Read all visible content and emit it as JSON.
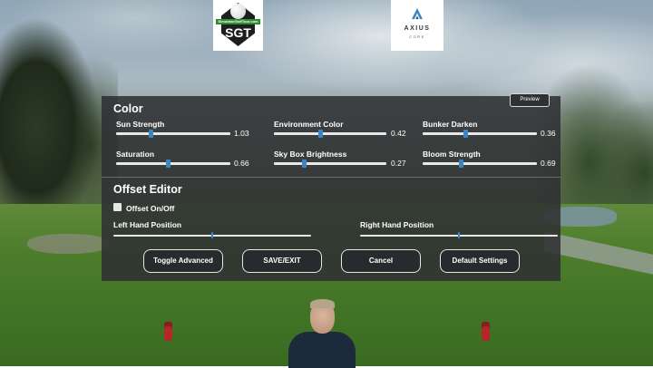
{
  "logos": {
    "sgt": {
      "band_text": "SimulatorGolfTour.com",
      "mark": "SGT"
    },
    "axius": {
      "name": "AXIUS",
      "sub": "CORE"
    }
  },
  "panel": {
    "color_title": "Color",
    "preview_label": "Preview",
    "color_sliders": [
      {
        "label": "Sun Strength",
        "value": "1.03",
        "level": 0.3
      },
      {
        "label": "Environment Color",
        "value": "0.42",
        "level": 0.41
      },
      {
        "label": "Bunker Darken",
        "value": "0.36",
        "level": 0.37
      },
      {
        "label": "Saturation",
        "value": "0.66",
        "level": 0.45
      },
      {
        "label": "Sky Box Brightness",
        "value": "0.27",
        "level": 0.27
      },
      {
        "label": "Bloom Strength",
        "value": "0.69",
        "level": 0.33
      }
    ],
    "offset_title": "Offset Editor",
    "offset_toggle_label": "Offset On/Off",
    "offset_toggle_checked": false,
    "left_hand_label": "Left Hand Position",
    "left_hand_level": 0.5,
    "right_hand_label": "Right Hand Position",
    "right_hand_level": 0.5,
    "buttons": {
      "toggle_advanced": "Toggle Advanced",
      "save_exit": "SAVE/EXIT",
      "cancel": "Cancel",
      "default_settings": "Default Settings"
    }
  },
  "colors": {
    "slider_thumb": "#3a86c6",
    "panel_bg": "#2d2f32",
    "tee_marker": "#b5262b"
  }
}
